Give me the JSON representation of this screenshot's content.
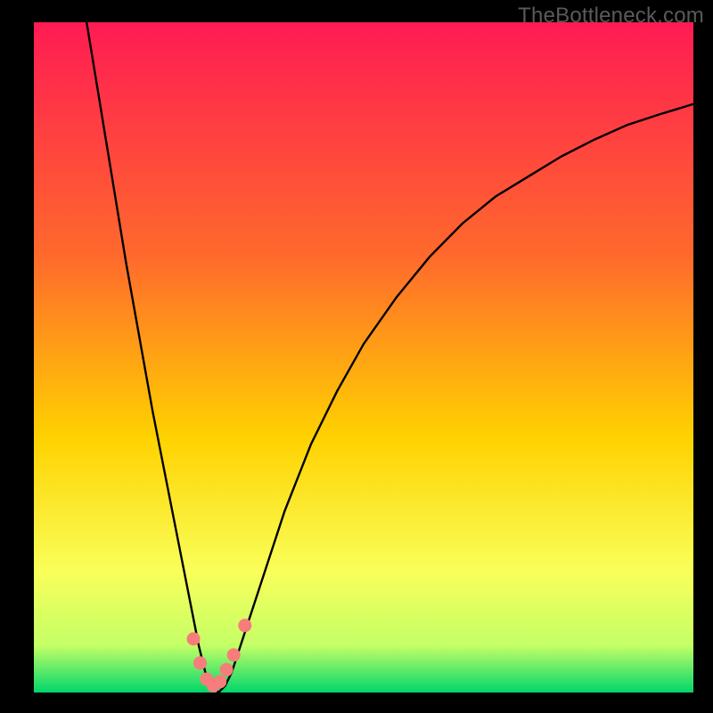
{
  "watermark": "TheBottleneck.com",
  "colors": {
    "bg": "#000000",
    "grad_top": "#ff1b53",
    "grad_mid1": "#ff6a2c",
    "grad_mid2": "#ffd200",
    "grad_mid3": "#f9ff5a",
    "grad_low": "#c4ff66",
    "grad_bottom": "#00d66b",
    "curve": "#000000",
    "dot": "#f77c7c"
  },
  "chart_data": {
    "type": "line",
    "title": "",
    "xlabel": "",
    "ylabel": "",
    "xlim": [
      0,
      100
    ],
    "ylim": [
      0,
      100
    ],
    "series": [
      {
        "name": "bottleneck-curve",
        "x": [
          8,
          10,
          12,
          14,
          16,
          18,
          20,
          22,
          24,
          25,
          26,
          27,
          28,
          29,
          30,
          32,
          34,
          38,
          42,
          46,
          50,
          55,
          60,
          65,
          70,
          75,
          80,
          85,
          90,
          95,
          100
        ],
        "y": [
          100,
          88,
          76,
          64,
          53,
          42,
          32,
          22,
          12,
          7,
          3,
          1,
          0,
          1,
          3,
          9,
          15,
          27,
          37,
          45,
          52,
          59,
          65,
          70,
          74,
          77,
          80,
          82.5,
          84.7,
          86.3,
          87.8
        ]
      }
    ],
    "markers": {
      "name": "bottleneck-dots",
      "x": [
        24.2,
        25.2,
        26.2,
        27.2,
        28.2,
        29.2,
        30.3,
        32.0
      ],
      "y": [
        8.0,
        4.4,
        2.0,
        1.0,
        1.6,
        3.4,
        5.6,
        10.0
      ]
    }
  }
}
